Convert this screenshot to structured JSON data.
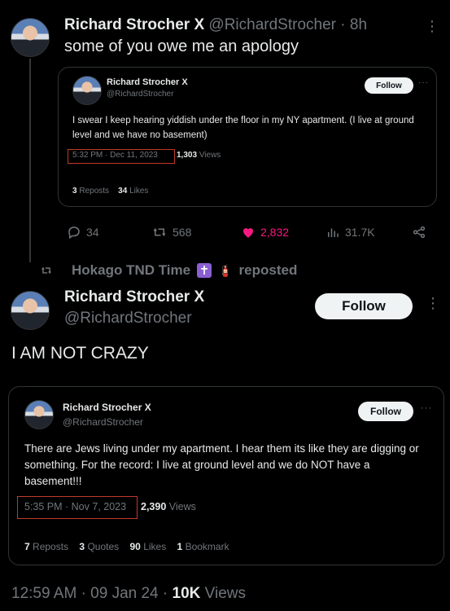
{
  "tweet1": {
    "name": "Richard Strocher",
    "x_badge": "X",
    "handle": "@RichardStrocher",
    "sep": "·",
    "time": "8h",
    "more": "⋮",
    "text": "some of you owe me an apology",
    "quote": {
      "name": "Richard Strocher",
      "x_badge": "X",
      "handle": "@RichardStrocher",
      "follow": "Follow",
      "more": "···",
      "text": "I swear I keep hearing yiddish under the floor in my NY apartment. (I live at ground level and we have no basement)",
      "timestamp": "5:32 PM · Dec 11, 2023",
      "views_count": "1,303",
      "views_label": "Views",
      "reposts_count": "3",
      "reposts_label": "Reposts",
      "likes_count": "34",
      "likes_label": "Likes"
    },
    "actions": {
      "replies": "34",
      "reposts": "568",
      "likes": "2,832",
      "views": "31.7K"
    }
  },
  "repost_banner": {
    "user": "Hokago TND Time",
    "emoji": "🧯",
    "label": "reposted"
  },
  "tweet2": {
    "name": "Richard Strocher",
    "x_badge": "X",
    "handle": "@RichardStrocher",
    "follow": "Follow",
    "more": "⋮",
    "text": "I AM NOT CRAZY",
    "quote": {
      "name": "Richard Strocher",
      "x_badge": "X",
      "handle": "@RichardStrocher",
      "follow": "Follow",
      "more": "···",
      "text": "There are Jews living under my apartment. I hear them its like they are digging or something. For the record: I live at ground level and we do NOT have a basement!!!",
      "timestamp": "5:35 PM · Nov 7, 2023",
      "views_count": "2,390",
      "views_label": "Views",
      "reposts_count": "7",
      "reposts_label": "Reposts",
      "quotes_count": "3",
      "quotes_label": "Quotes",
      "likes_count": "90",
      "likes_label": "Likes",
      "bookmarks_count": "1",
      "bookmarks_label": "Bookmark"
    },
    "footer": {
      "time": "12:59 AM · 09 Jan 24 ·",
      "views_count": "10K",
      "views_label": "Views"
    }
  },
  "colors": {
    "background": "#000000",
    "text": "#e7e9ea",
    "muted": "#71767b",
    "like": "#f91880",
    "highlight_box": "#c0392b",
    "follow_bg": "#eff3f4"
  },
  "icons": [
    "reply-icon",
    "repost-icon",
    "like-icon",
    "views-icon",
    "share-icon",
    "more-icon"
  ]
}
